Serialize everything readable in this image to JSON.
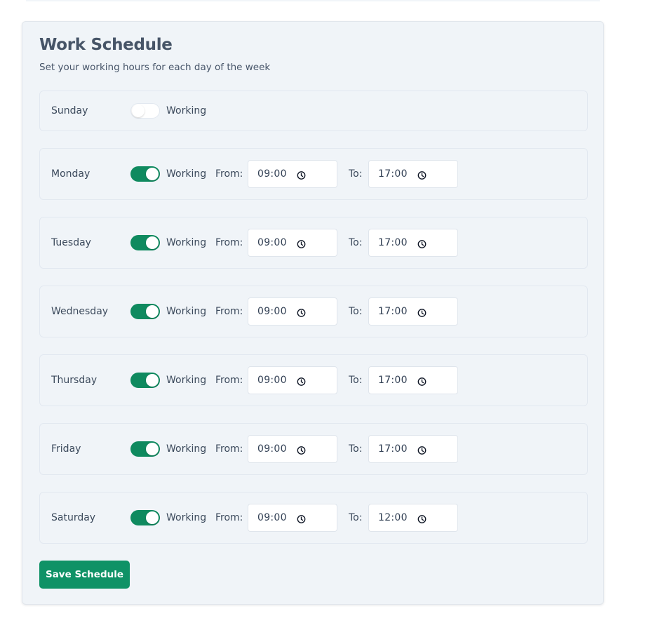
{
  "header": {
    "title": "Work Schedule",
    "subtitle": "Set your working hours for each day of the week"
  },
  "labels": {
    "working": "Working",
    "from": "From:",
    "to": "To:"
  },
  "days": [
    {
      "name": "Sunday",
      "working": false
    },
    {
      "name": "Monday",
      "working": true,
      "from": "09:00",
      "to": "17:00"
    },
    {
      "name": "Tuesday",
      "working": true,
      "from": "09:00",
      "to": "17:00"
    },
    {
      "name": "Wednesday",
      "working": true,
      "from": "09:00",
      "to": "17:00"
    },
    {
      "name": "Thursday",
      "working": true,
      "from": "09:00",
      "to": "17:00"
    },
    {
      "name": "Friday",
      "working": true,
      "from": "09:00",
      "to": "17:00"
    },
    {
      "name": "Saturday",
      "working": true,
      "from": "09:00",
      "to": "12:00"
    }
  ],
  "actions": {
    "save_label": "Save Schedule"
  },
  "colors": {
    "accent": "#0f9266",
    "toggle_on": "#0f8a5f",
    "card_background": "#f0f4f8"
  },
  "icons": {
    "time_picker": "clock-icon"
  }
}
